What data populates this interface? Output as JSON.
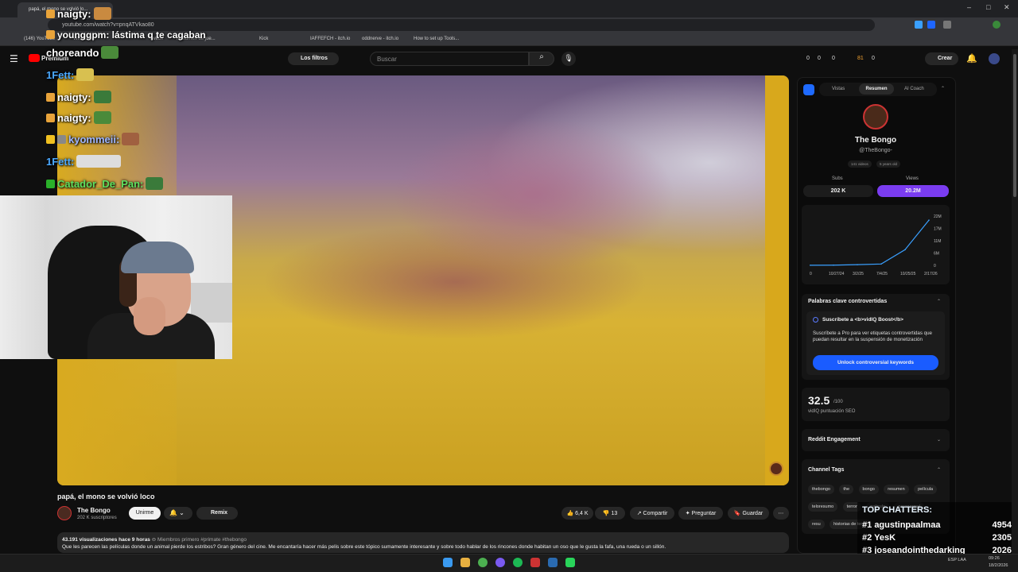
{
  "browser": {
    "tab_title": "papá, el mono se volvió lo...",
    "url": "youtube.com/watch?v=pnqATVkao80",
    "bookmarks": [
      "(146) YouTube",
      "WhatsApp",
      "Twitch",
      "Resumen de jue...",
      "Kick",
      "IAFFEFCH - itch.io",
      "oddnerve - itch.io",
      "How to set up Tools..."
    ]
  },
  "youtube": {
    "logo_text": "Premium",
    "filters_label": "Los filtros",
    "search_placeholder": "Buscar",
    "create_label": "Crear",
    "stats": [
      "0",
      "0",
      "0",
      "81",
      "0"
    ]
  },
  "video": {
    "title": "papá, el mono se volvió loco",
    "channel_name": "The Bongo",
    "channel_subs": "202 K suscriptores",
    "join_label": "Unirme",
    "remix_label": "Remix",
    "likes": "6,4 K",
    "dislikes": "13",
    "share_label": "Compartir",
    "ask_label": "Preguntar",
    "save_label": "Guardar",
    "views_meta": "43.191 visualizaciones  hace 9 horas",
    "members_first": "Miembros primero",
    "hashtags": "#primate #thebongo",
    "description": "Que les parecen las películas donde un animal pierde los estribos? Gran género del cine. Me encantaría hacer más pelis sobre este tópico sumamente interesante y sobre todo hablar de los rincones donde habitan un oso que le gusta la fafa, una rueda o un sillón."
  },
  "chat": [
    {
      "user": "naigty:",
      "text": ""
    },
    {
      "user": "younggpm:",
      "text": "lástima q te cagaban"
    },
    {
      "user": "choreando",
      "text": ""
    },
    {
      "user": "1Fett:",
      "text": ""
    },
    {
      "user": "naigty:",
      "text": ""
    },
    {
      "user": "naigty:",
      "text": ""
    },
    {
      "user": "kyommeii:",
      "text": ""
    },
    {
      "user": "1Fett:",
      "text": ""
    },
    {
      "user": "Catador_De_Pan:",
      "text": ""
    }
  ],
  "vidiq": {
    "tabs": [
      "Vistas",
      "Resumen",
      "AI Coach"
    ],
    "channel_name": "The Bongo",
    "channel_handle": "@TheBongo-",
    "videos": "141 videos",
    "age": "5 years old",
    "subs_label": "Subs",
    "subs_value": "202 K",
    "views_label": "Views",
    "views_value": "20.2M",
    "chart_ylabels": [
      "22M",
      "17M",
      "11M",
      "6M",
      "0"
    ],
    "chart_xlabels": [
      "0",
      "10/27/24",
      "3/2/25",
      "7/4/25",
      "10/25/25",
      "2/17/26"
    ],
    "controversial_title": "Palabras clave controvertidas",
    "boost_title": "Suscríbete a <b>vidIQ Boost</b>",
    "boost_text": "Suscríbete a Pro para ver etiquetas controvertidas que puedan resultar en la suspensión de monetización",
    "unlock_label": "Unlock controversial keywords",
    "seo_score": "32.5",
    "seo_max": "/100",
    "seo_label": "vidIQ puntuación SEO",
    "reddit_label": "Reddit Engagement",
    "tags_label": "Channel Tags",
    "tags": [
      "thebongo",
      "the",
      "bongo",
      "resumen",
      "película",
      "teloresumo",
      "terror",
      "pelicula",
      "paranormal",
      "resu",
      "historias de terror"
    ]
  },
  "chart_data": {
    "type": "line",
    "x": [
      "10/27/24",
      "3/2/25",
      "7/4/25",
      "10/25/25",
      "2/17/26"
    ],
    "values": [
      0.1,
      0.3,
      0.6,
      7,
      20.2
    ],
    "ylabel": "",
    "ylim": [
      0,
      22
    ]
  },
  "top_chatters": {
    "title": "TOP CHATTERS:",
    "rows": [
      {
        "rank": "#1",
        "name": "agustinpaalmaa",
        "count": "4954"
      },
      {
        "rank": "#2",
        "name": "YesK",
        "count": "2305"
      },
      {
        "rank": "#3",
        "name": "joseandointhedarking",
        "count": "2026"
      }
    ]
  },
  "taskbar": {
    "lang": "ESP LAA",
    "time": "09:26",
    "date": "18/2/2026"
  }
}
